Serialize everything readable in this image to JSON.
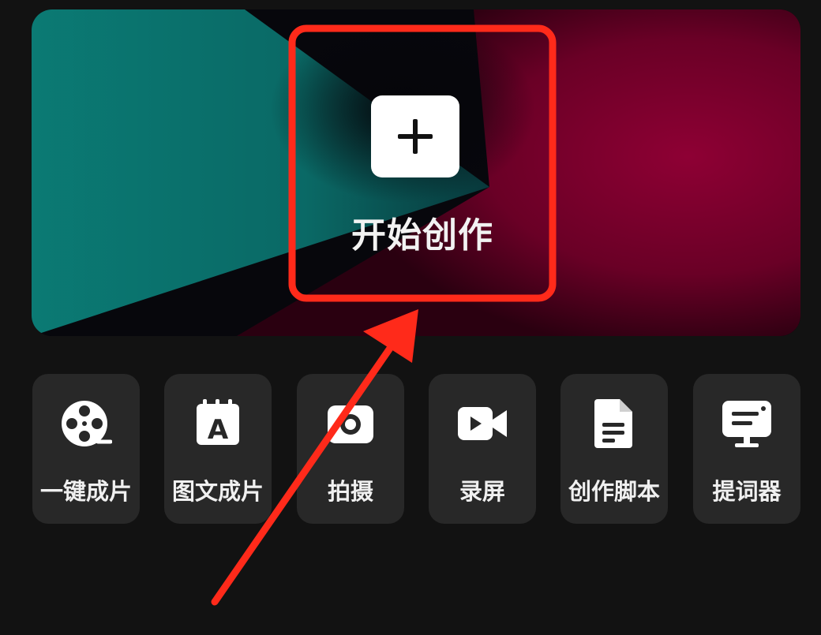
{
  "hero": {
    "start_label": "开始创作",
    "start_icon": "plus-icon"
  },
  "tools": [
    {
      "label": "一键成片",
      "icon": "film-reel-icon"
    },
    {
      "label": "图文成片",
      "icon": "text-document-icon"
    },
    {
      "label": "拍摄",
      "icon": "camera-icon"
    },
    {
      "label": "录屏",
      "icon": "video-camera-icon"
    },
    {
      "label": "创作脚本",
      "icon": "script-icon"
    },
    {
      "label": "提词器",
      "icon": "teleprompter-icon"
    }
  ],
  "colors": {
    "background": "#121212",
    "tile": "#282828",
    "teal": "#0a8a80",
    "crimson": "#8a0030",
    "annotation_red": "#ff2a1a"
  }
}
